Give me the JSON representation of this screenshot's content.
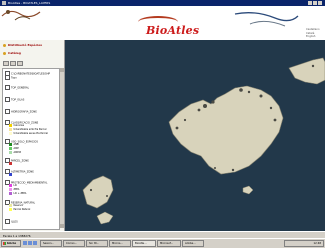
{
  "window": {
    "title": "BioAtles - BIOATLES_LAYERS"
  },
  "banner": {
    "logo": "BioAtles",
    "links": [
      "Castellano",
      "Català",
      "English"
    ]
  },
  "nav": [
    {
      "label": "Distribució Espècies"
    },
    {
      "label": "Catàleg"
    }
  ],
  "layers": [
    {
      "label": "C:\\CARBONATES\\BIOATLES\\SHP",
      "checked": true
    },
    {
      "label": "Topo",
      "checked": true
    },
    {
      "label": "TOP_GENERAL",
      "checked": false
    },
    {
      "label": "TOP_ISLAS",
      "checked": false
    },
    {
      "label": "HIDROGRAFIA_ZONE",
      "checked": false
    },
    {
      "label": "CLASSIFICACIO_ZONE",
      "checked": true
    },
    {
      "label": "USO_SOLO_ESPACIOS",
      "checked": true
    },
    {
      "label": "PARCEL_ZONE",
      "checked": true
    },
    {
      "label": "ALTIMETRIA_ZONE",
      "checked": true
    },
    {
      "label": "PROTECCIO_MEDIAMBIENTAL",
      "checked": true
    },
    {
      "label": "RESERVA_NATURAL",
      "checked": true
    },
    {
      "label": "ILLES",
      "checked": true
    }
  ],
  "legend_groups": [
    [
      {
        "label": "Calcàries",
        "color": "#f0d000"
      },
      {
        "label": "Urbanitzable amb Pla Parcial",
        "color": "#f7e49a"
      },
      {
        "label": "Urbanitzable sense Pla Parcial",
        "color": "#fffbd0"
      }
    ],
    [
      {
        "label": "ANEI",
        "color": "#228b22"
      },
      {
        "label": "ARIP",
        "color": "#66cc66"
      },
      {
        "label": "ARIP-B",
        "color": "#aaddaa"
      }
    ],
    [
      {
        "label": "",
        "color": "#cc3333"
      }
    ],
    [
      {
        "label": "",
        "color": "#3344cc"
      }
    ],
    [
      {
        "label": "LIC",
        "color": "#e040e0"
      },
      {
        "label": "ZEPA",
        "color": "#f090f0"
      },
      {
        "label": "LIC + ZEPA",
        "color": "#b060d0"
      }
    ],
    [
      {
        "label": "Reserva",
        "color": "#e8e8a0"
      },
      {
        "label": "Parcial Natural",
        "color": "#ffff55"
      }
    ]
  ],
  "status": {
    "scale": "Escala 1 a 1388276"
  },
  "taskbar": {
    "start": "Inicio",
    "buttons": [
      "Sesion...",
      "Correo...",
      "Sin tit...",
      "Micros...",
      "BioAtle...",
      "Microsof...",
      "Adobe..."
    ],
    "clock": "12:48"
  },
  "colors": {
    "sea": "#22384a",
    "land": "#d8d3bb",
    "titlebar": "#0a246a",
    "logo": "#cc1a1a"
  }
}
